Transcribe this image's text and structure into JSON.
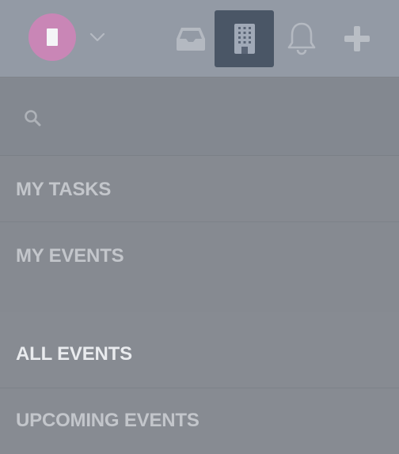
{
  "header": {
    "avatar_label": "user-avatar",
    "icons": {
      "chevron": "chevron-down-icon",
      "inbox": "inbox-icon",
      "building": "building-icon",
      "bell": "bell-icon",
      "plus": "plus-icon"
    },
    "active_icon": "building-icon"
  },
  "search": {
    "placeholder": "",
    "value": ""
  },
  "nav": {
    "items": [
      {
        "label": "MY TASKS"
      },
      {
        "label": "MY EVENTS"
      },
      {
        "label": "ALL EVENTS",
        "active": true
      },
      {
        "label": "UPCOMING EVENTS"
      }
    ]
  },
  "colors": {
    "avatar": "#c986b6",
    "active_tab_bg": "#4a5666",
    "active_text": "#e9ebee",
    "text": "#c3c6cb"
  }
}
